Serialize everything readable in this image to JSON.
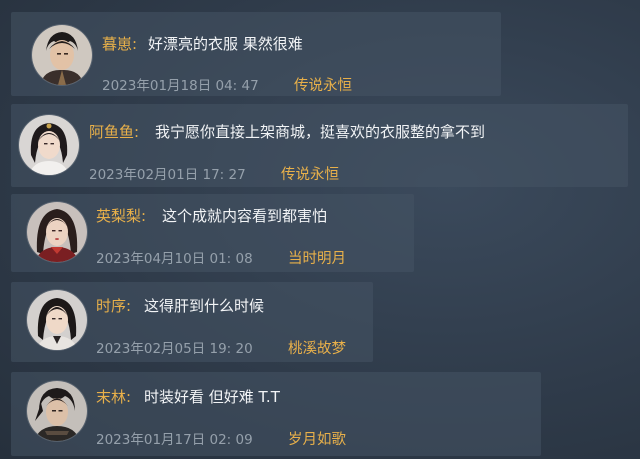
{
  "theme": {
    "name_color": "#e8b04a",
    "server_color": "#e8b04a",
    "text_color": "#f2f4f6",
    "meta_color": "#95a0ab"
  },
  "comments": [
    {
      "name": "暮崽:",
      "content": "好漂亮的衣服  果然很难",
      "date": "2023年01月18日  04: 47",
      "server": "传说永恒",
      "avatar": "male-swordsman-avatar"
    },
    {
      "name": "阿鱼鱼:",
      "content": "我宁愿你直接上架商城，挺喜欢的衣服整的拿不到",
      "date": "2023年02月01日  17: 27",
      "server": "传说永恒",
      "avatar": "female-white-robe-avatar"
    },
    {
      "name": "英梨梨:",
      "content": "这个成就内容看到都害怕",
      "date": "2023年04月10日  01: 08",
      "server": "当时明月",
      "avatar": "female-red-robe-avatar"
    },
    {
      "name": "时序:",
      "content": "这得肝到什么时候",
      "date": "2023年02月05日  19: 20",
      "server": "桃溪故梦",
      "avatar": "female-dark-hair-avatar"
    },
    {
      "name": "末林:",
      "content": "时装好看  但好难  T.T",
      "date": "2023年01月17日  02: 09",
      "server": "岁月如歌",
      "avatar": "male-dark-armor-avatar"
    }
  ]
}
